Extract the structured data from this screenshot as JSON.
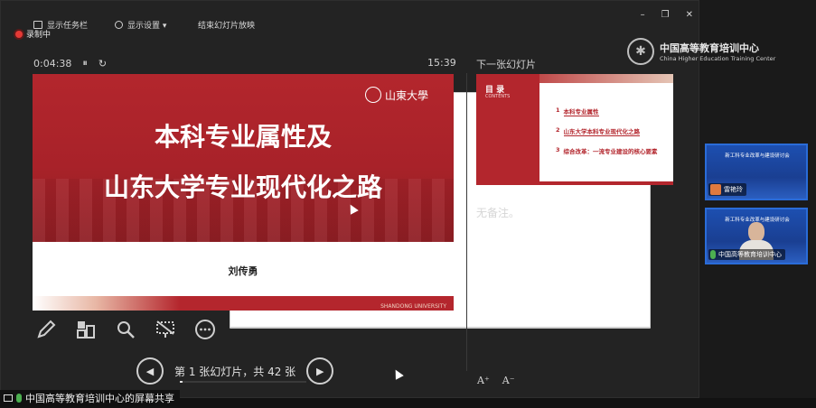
{
  "toolbar": {
    "taskbar_label": "显示任务栏",
    "display_settings_label": "显示设置 ▾",
    "end_show_label": "结束幻灯片放映"
  },
  "window_controls": {
    "minimize": "–",
    "maximize": "❐",
    "close": "✕"
  },
  "recording": {
    "label": "录制中"
  },
  "timer": {
    "elapsed": "0:04:38",
    "pause": "⏸",
    "reset": "↻",
    "clock": "15:39"
  },
  "current_slide": {
    "logo_text": "山東大學",
    "title_line1": "本科专业属性及",
    "title_line2": "山东大学专业现代化之路",
    "author": "刘传勇",
    "footer_en": "SHANDONG UNIVERSITY"
  },
  "tools": [
    "pen-icon",
    "see-all-slides-icon",
    "zoom-icon",
    "black-screen-icon",
    "more-icon"
  ],
  "navigation": {
    "prev": "◀",
    "next": "▶",
    "slide_counter": "第 1 张幻灯片，共 42 张",
    "current": 1,
    "total": 42
  },
  "next_slide": {
    "label": "下一张幻灯片",
    "toc_title": "目 录",
    "toc_en": "CONTENTS",
    "items": [
      {
        "num": "1",
        "text": "本科专业属性"
      },
      {
        "num": "2",
        "text": "山东大学本科专业现代化之路"
      },
      {
        "num": "3",
        "text": "综合改革：一流专业建设的核心要素"
      }
    ]
  },
  "notes": {
    "text": "无备注。"
  },
  "font_controls": {
    "increase": "A⁺",
    "decrease": "A⁻"
  },
  "brand": {
    "name_cn": "中国高等教育培训中心",
    "name_en": "China Higher Education Training Center"
  },
  "videos": [
    {
      "title": "新工科专业改革与建设研讨会",
      "name": "雷艳玲"
    },
    {
      "title": "新工科专业改革与建设研讨会",
      "name": "中国高等教育培训中心"
    }
  ],
  "screen_share": {
    "label": "中国高等教育培训中心的屏幕共享"
  },
  "colors": {
    "slide_red": "#b3262d",
    "accent_blue": "#2a6cd8",
    "recording_red": "#e53935"
  }
}
